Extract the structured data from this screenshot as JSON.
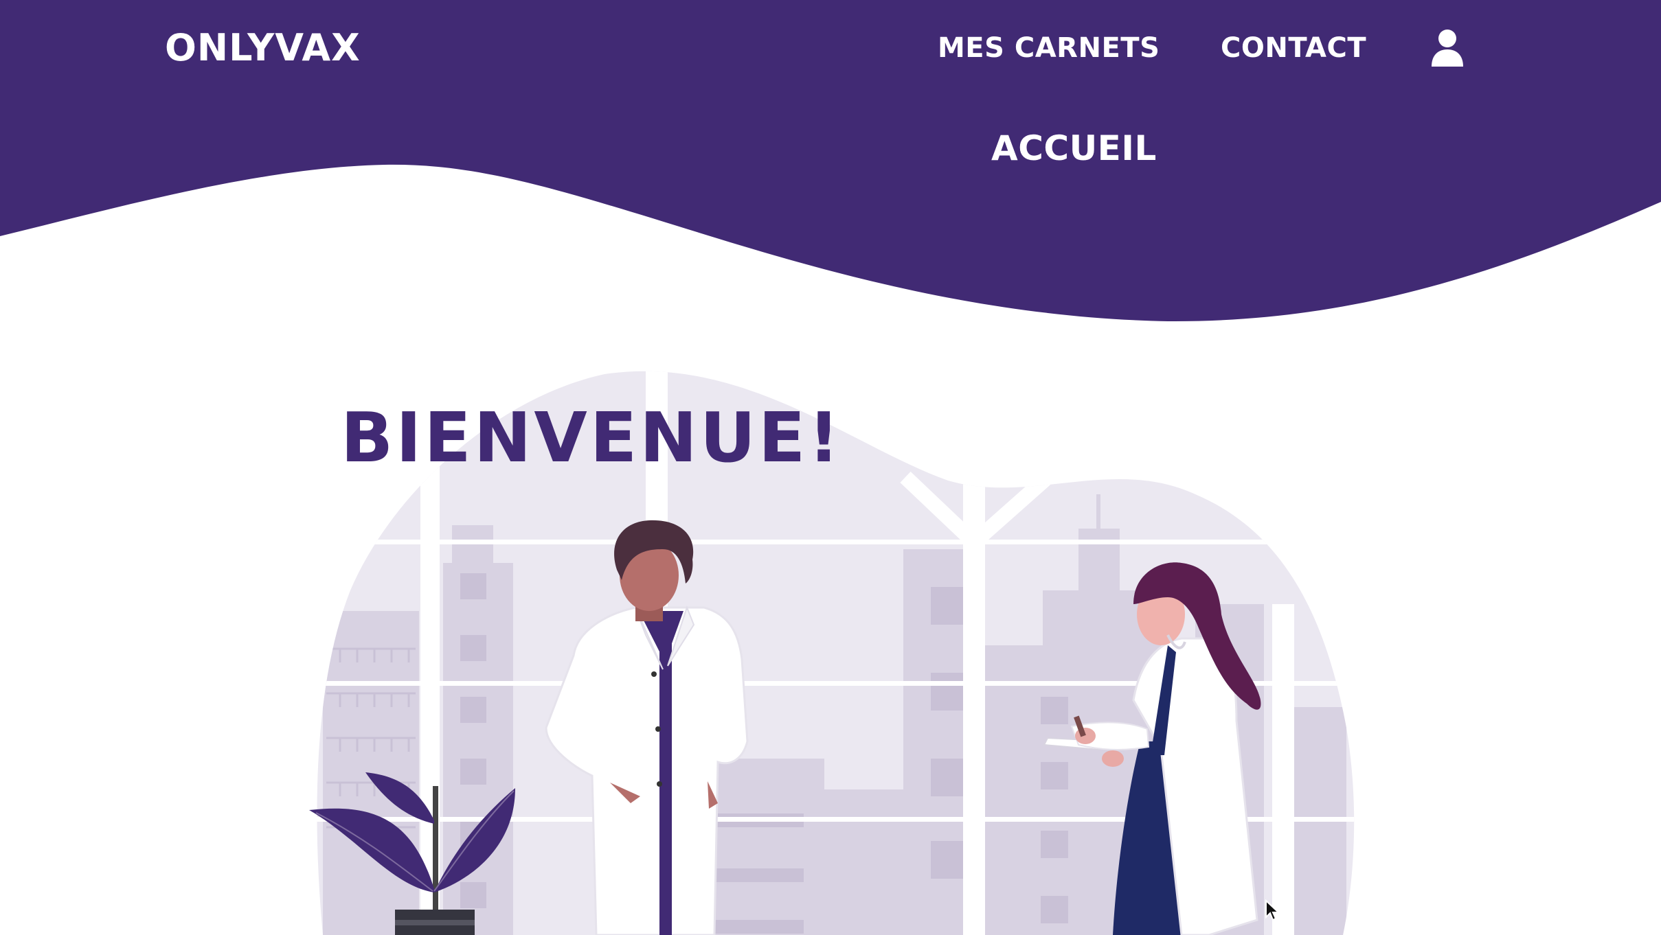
{
  "header": {
    "brand": "ONLYVAX",
    "nav": {
      "carnets": "MES CARNETS",
      "contact": "CONTACT",
      "accueil": "ACCUEIL"
    },
    "user_icon": "user-icon"
  },
  "hero": {
    "title": "BIENVENUE!",
    "illustration": "doctors-illustration"
  },
  "colors": {
    "brand_purple": "#412a74",
    "background": "#ffffff",
    "illustration_bg": "#ebe8f1",
    "building": "#d8d2e2",
    "accent_dark": "#5b1e4f",
    "skin": "#b56f6b",
    "navy": "#1f2a66"
  }
}
